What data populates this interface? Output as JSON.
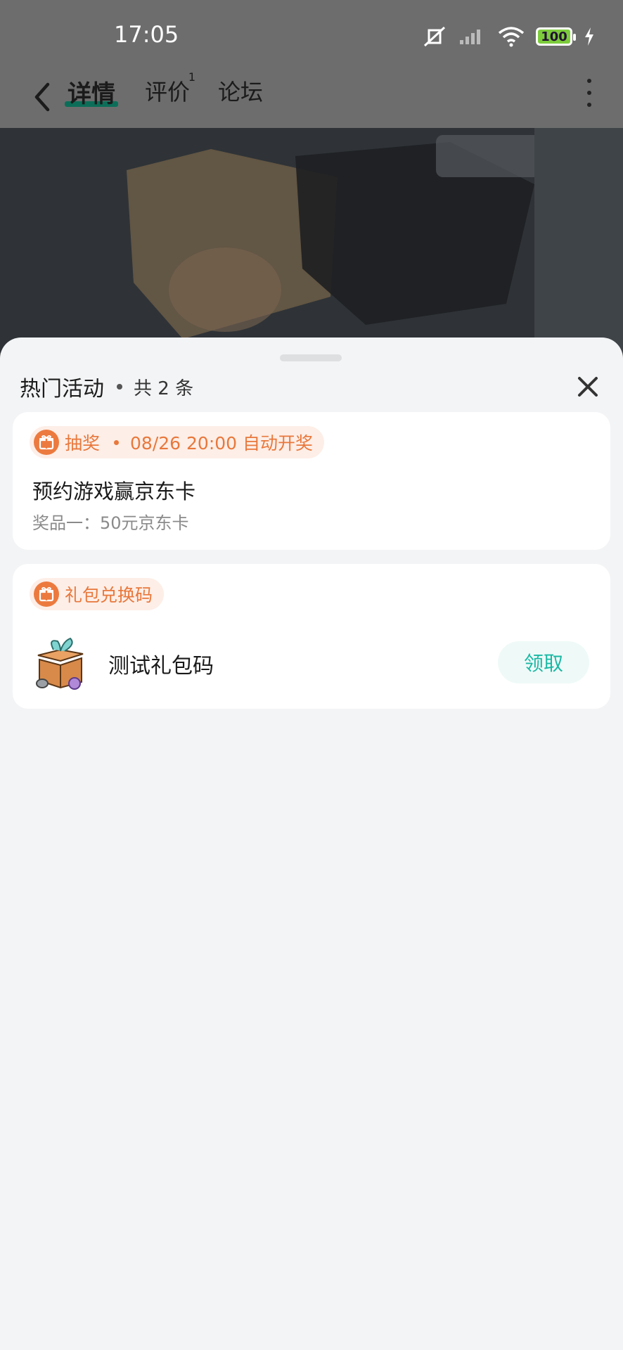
{
  "status_bar": {
    "time": "17:05",
    "battery": "100"
  },
  "nav": {
    "tabs": [
      {
        "label": "详情",
        "active": true
      },
      {
        "label": "评价",
        "badge": "1"
      },
      {
        "label": "论坛"
      }
    ]
  },
  "sheet": {
    "title": "热门活动",
    "count_text": "共 2 条",
    "cards": [
      {
        "tag_type": "抽奖",
        "tag_detail": "08/26 20:00 自动开奖",
        "title": "预约游戏赢京东卡",
        "subtitle": "奖品一：50元京东卡"
      },
      {
        "tag_type": "礼包兑换码",
        "item_name": "测试礼包码",
        "button_label": "领取"
      }
    ]
  },
  "colors": {
    "accent_orange": "#e8783c",
    "accent_teal": "#1ab8a4",
    "tab_underline": "#0c6e58"
  }
}
